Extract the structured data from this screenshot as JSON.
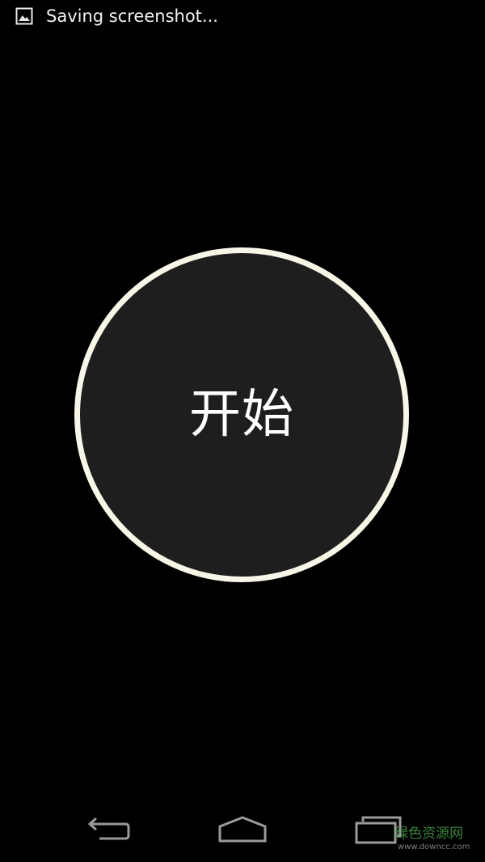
{
  "status_bar": {
    "notification_icon": "image-icon",
    "notification_text": "Saving screenshot..."
  },
  "main": {
    "start_button_label": "开始"
  },
  "nav_bar": {
    "back_icon": "back-arrow-icon",
    "home_icon": "home-icon",
    "recent_icon": "recent-apps-icon"
  },
  "watermark": {
    "main_text": "绿色资源网",
    "sub_text": "www.downcc.com"
  },
  "colors": {
    "background": "#000000",
    "button_fill": "#1e1e1e",
    "button_ring": "#f7f6e7",
    "watermark_green": "#4caf50"
  }
}
